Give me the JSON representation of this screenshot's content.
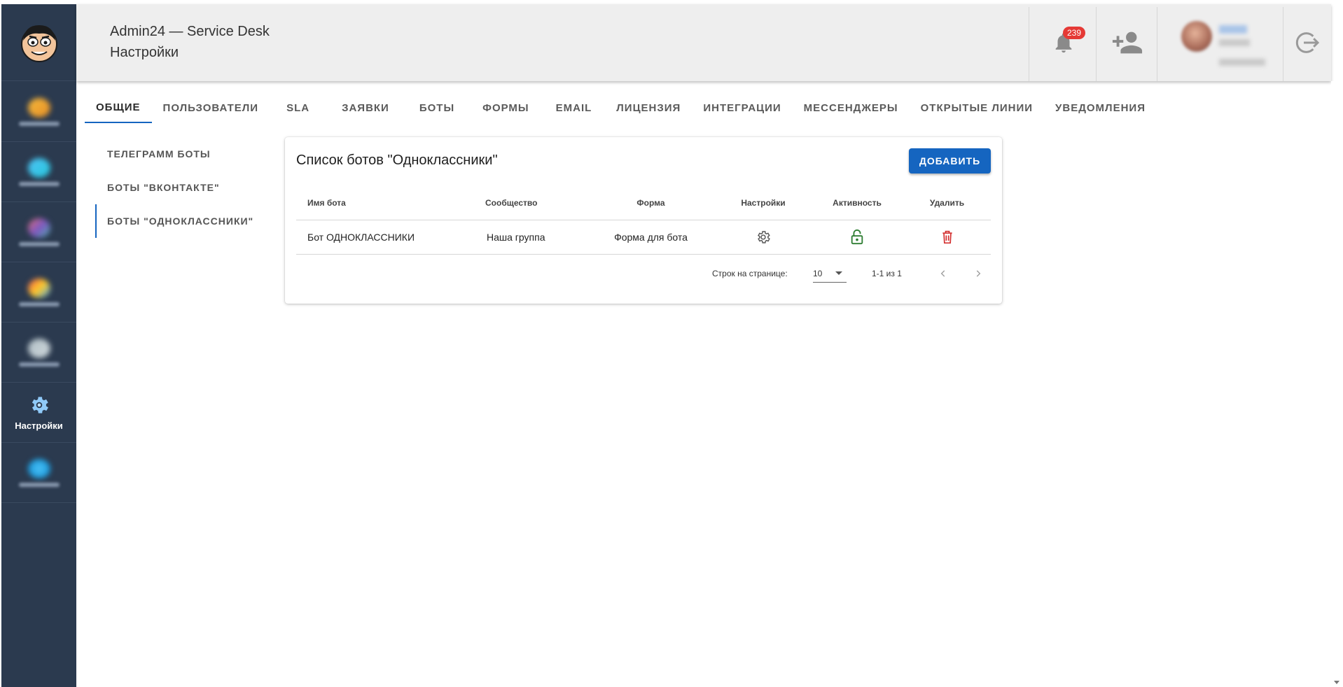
{
  "header": {
    "title": "Admin24 — Service Desk",
    "subtitle": "Настройки",
    "notification_count": "239"
  },
  "sidebar": {
    "items": [
      {
        "icon": "blurred-icon",
        "label": ""
      },
      {
        "icon": "blurred-icon",
        "label": ""
      },
      {
        "icon": "blurred-icon",
        "label": ""
      },
      {
        "icon": "blurred-icon",
        "label": ""
      },
      {
        "icon": "blurred-icon",
        "label": ""
      },
      {
        "icon": "gear-icon",
        "label": "Настройки",
        "active": true
      },
      {
        "icon": "blurred-icon",
        "label": ""
      }
    ]
  },
  "tabs": [
    "Общие",
    "Пользователи",
    "SLA",
    "Заявки",
    "Боты",
    "Формы",
    "EMAIL",
    "Лицензия",
    "Интеграции",
    "Мессенджеры",
    "Открытые линии",
    "Уведомления"
  ],
  "subnav": [
    "Телеграмм боты",
    "Боты \"ВКонтакте\"",
    "Боты \"Одноклассники\""
  ],
  "card": {
    "title": "Список ботов \"Одноклассники\"",
    "add_button": "Добавить",
    "columns": [
      "Имя бота",
      "Сообщество",
      "Форма",
      "Настройки",
      "Активность",
      "Удалить"
    ],
    "rows": [
      {
        "name": "Бот ОДНОКЛАССНИКИ",
        "community": "Наша группа",
        "form": "Форма для бота"
      }
    ],
    "pagination": {
      "rows_per_page_label": "Строк на странице:",
      "rows_per_page": "10",
      "range": "1-1 из 1"
    }
  },
  "colors": {
    "sidebar_bg": "#2b3a4f",
    "accent": "#1565c0",
    "active_green": "#2e7d32",
    "delete_red": "#d32f2f",
    "badge_red": "#e53935"
  }
}
